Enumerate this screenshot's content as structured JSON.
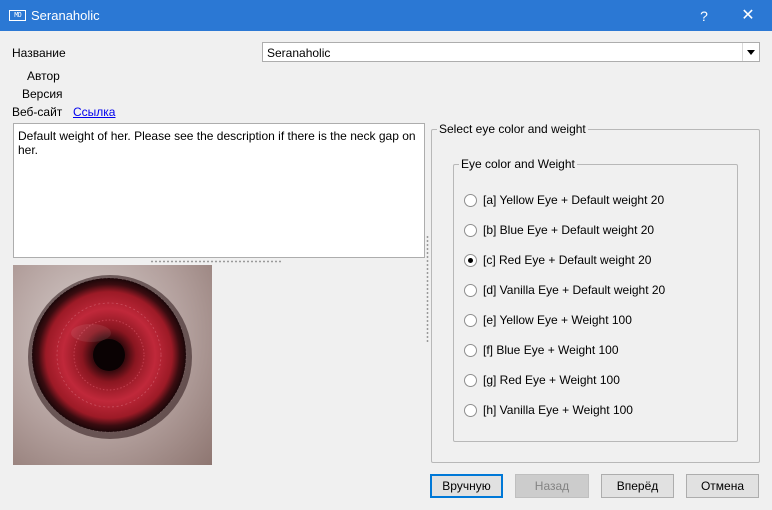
{
  "window": {
    "app_icon": "mo-icon",
    "app_icon_text": "MO",
    "title": "Seranaholic",
    "help_label": "?",
    "close_label": "✕"
  },
  "fields": {
    "name_label": "Название",
    "name_value": "Seranaholic",
    "author_label": "Автор",
    "version_label": "Версия",
    "website_label": "Веб-сайт",
    "website_link": "Ссылка"
  },
  "description": "Default weight of her. Please see the description if there is the neck gap on her.",
  "options_group": {
    "title": "Select eye color and weight",
    "inner_title": "Eye color and Weight",
    "options": [
      {
        "label": "[a] Yellow Eye + Default weight 20",
        "checked": false
      },
      {
        "label": "[b] Blue Eye + Default weight 20",
        "checked": false
      },
      {
        "label": "[c] Red Eye + Default weight 20",
        "checked": true
      },
      {
        "label": "[d] Vanilla Eye + Default weight 20",
        "checked": false
      },
      {
        "label": "[e] Yellow Eye + Weight 100",
        "checked": false
      },
      {
        "label": "[f] Blue Eye + Weight 100",
        "checked": false
      },
      {
        "label": "[g] Red Eye + Weight 100",
        "checked": false
      },
      {
        "label": "[h] Vanilla Eye + Weight 100",
        "checked": false
      }
    ]
  },
  "buttons": {
    "manual": "Вручную",
    "back": "Назад",
    "next": "Вперёд",
    "cancel": "Отмена"
  },
  "colors": {
    "titlebar": "#2b78d4",
    "iris": "#b0202a"
  }
}
